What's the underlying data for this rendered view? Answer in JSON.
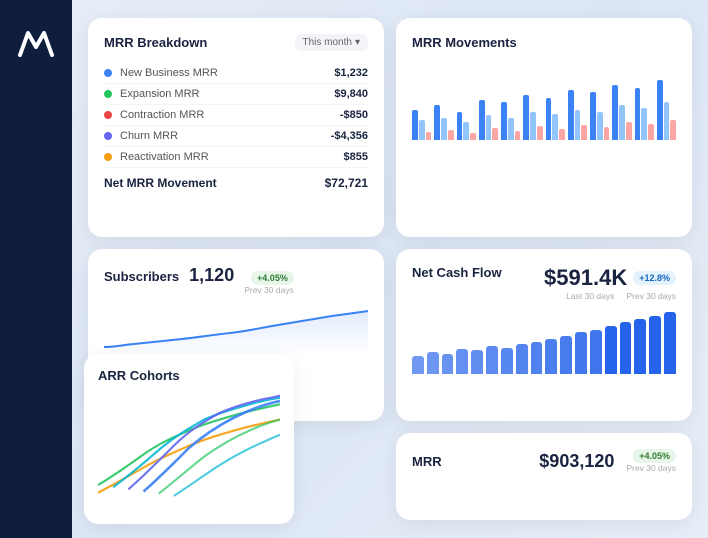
{
  "sidebar": {
    "logo": "M"
  },
  "mrr_breakdown": {
    "title": "MRR Breakdown",
    "period": "This month",
    "rows": [
      {
        "label": "New Business MRR",
        "value": "$1,232",
        "color": "#3b82f6",
        "num": "10"
      },
      {
        "label": "Expansion MRR",
        "value": "$9,840",
        "color": "#22c55e",
        "num": "6"
      },
      {
        "label": "Contraction MRR",
        "value": "-$850",
        "color": "#ef4444",
        "num": "9"
      },
      {
        "label": "Churn MRR",
        "value": "-$4,356",
        "color": "#6366f1",
        "num": "6"
      },
      {
        "label": "Reactivation MRR",
        "value": "$855",
        "color": "#f59e0b",
        "num": "8"
      }
    ],
    "net_label": "Net MRR Movement",
    "net_value": "$72,721"
  },
  "subscribers": {
    "title": "Subscribers",
    "value": "1,120",
    "badge": "+4.05%",
    "prev_label": "Prev 30 days"
  },
  "mrr_movements": {
    "title": "MRR Movements"
  },
  "net_cash_flow": {
    "title": "Net Cash Flow",
    "amount": "$591.4K",
    "badge": "+12.8%",
    "prev_label": "Prev 30 days",
    "last_label": "Last 30 days"
  },
  "mrr_bottom": {
    "title": "MRR",
    "value": "$903,120",
    "badge": "+4.05%",
    "prev_label": "Prev 30 days"
  },
  "arr_cohorts": {
    "title": "ARR Cohorts"
  }
}
